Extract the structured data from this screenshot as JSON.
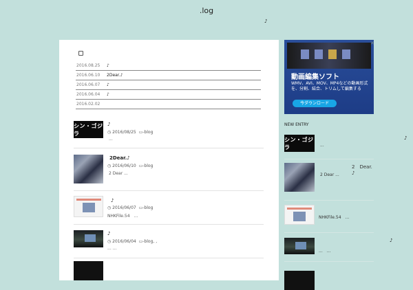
{
  "site": {
    "title": ".log",
    "note": "♪"
  },
  "news": [
    {
      "date": "2016.08.25",
      "title": "♪"
    },
    {
      "date": "2016.06.10",
      "title": "2Dear.♪"
    },
    {
      "date": "2016.06.07",
      "title": "♪"
    },
    {
      "date": "2016.06.04",
      "title": "♪"
    },
    {
      "date": "2016.02.02",
      "title": ""
    }
  ],
  "posts": [
    {
      "title": "♪",
      "date": "2016/08/25",
      "category": "-blog",
      "excerpt": "...",
      "thumb_text": "シン・ゴジラ"
    },
    {
      "title": "2Dear.♪",
      "date": "2016/06/10",
      "category": "-blog",
      "excerpt": "2 Dear ...",
      "thumb_text": ""
    },
    {
      "title": "♪",
      "date": "2016/06/07",
      "category": "-blog",
      "excerpt": "NHKFile.54　...",
      "thumb_text": ""
    },
    {
      "title": "♪",
      "date": "2016/06/04",
      "category": "-blog, ,",
      "excerpt": "... ...",
      "thumb_text": ""
    }
  ],
  "ad": {
    "headline": "動画編集ソフト",
    "body": "WMV、AVI、MOV、MP4などの動画形式を、分割、結合、トリムして編集する",
    "cta": "今ダウンロード",
    "close": "✕"
  },
  "sidebar": {
    "new_entry_title": "NEW ENTRY",
    "items": [
      {
        "title": "...",
        "thumb_text": "シン・ゴジラ",
        "note": "♪"
      },
      {
        "title": "2 Dear ...",
        "heading": "2　Dear.　♪"
      },
      {
        "title": "NHKFile.54　..."
      },
      {
        "title": "...　...",
        "note": "♪"
      }
    ]
  }
}
